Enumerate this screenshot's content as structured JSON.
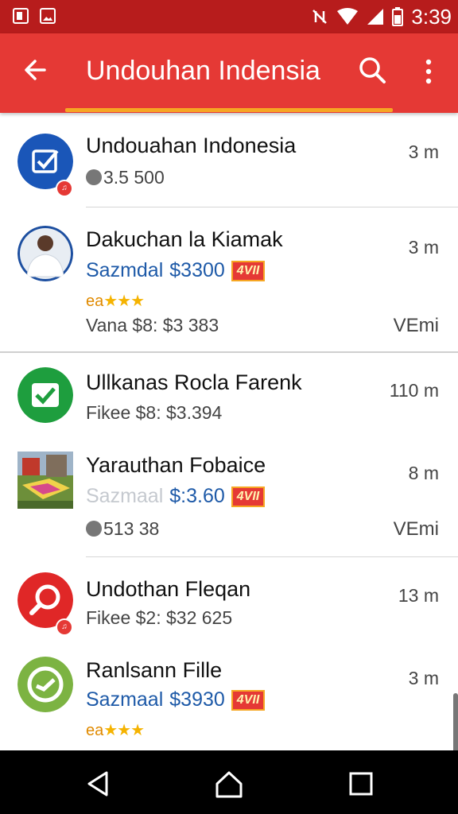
{
  "status_bar": {
    "time": "3:39"
  },
  "app_bar": {
    "title": "Undouhan Indensia"
  },
  "items": [
    {
      "title": "Undouahan Indonesia",
      "sub": "3.5 500",
      "time": "3 m"
    },
    {
      "title": "Dakuchan la Kiamak",
      "price_label": "Sazmdal",
      "price": "$3300",
      "tag": "4VII",
      "rating_prefix": "ea",
      "stars": "★★★",
      "sub": "Vana $8: $3 383",
      "time": "3 m",
      "extra": "VEmi"
    },
    {
      "title": "Ullkanas Rocla Farenk",
      "sub": "Fikee $8: $3.394",
      "time": "110 m"
    },
    {
      "title": "Yarauthan Fobaice",
      "price_label": "Sazmaal",
      "price": "$:3.60",
      "tag": "4VII",
      "sub": "513 38",
      "time": "8 m",
      "extra": "VEmi"
    },
    {
      "title": "Undothan Fleqan",
      "sub": "Fikee $2: $32 625",
      "time": "13 m"
    },
    {
      "title": "Ranlsann Fille",
      "price_label": "Sazmaal",
      "price": "$3930",
      "tag": "4VII",
      "rating_prefix": "ea",
      "stars": "★★★",
      "time": "3 m"
    }
  ],
  "colors": {
    "status_bar": "#b71c1c",
    "app_bar": "#e53935",
    "indicator": "#f6a623",
    "link_blue": "#1e5aa8"
  }
}
